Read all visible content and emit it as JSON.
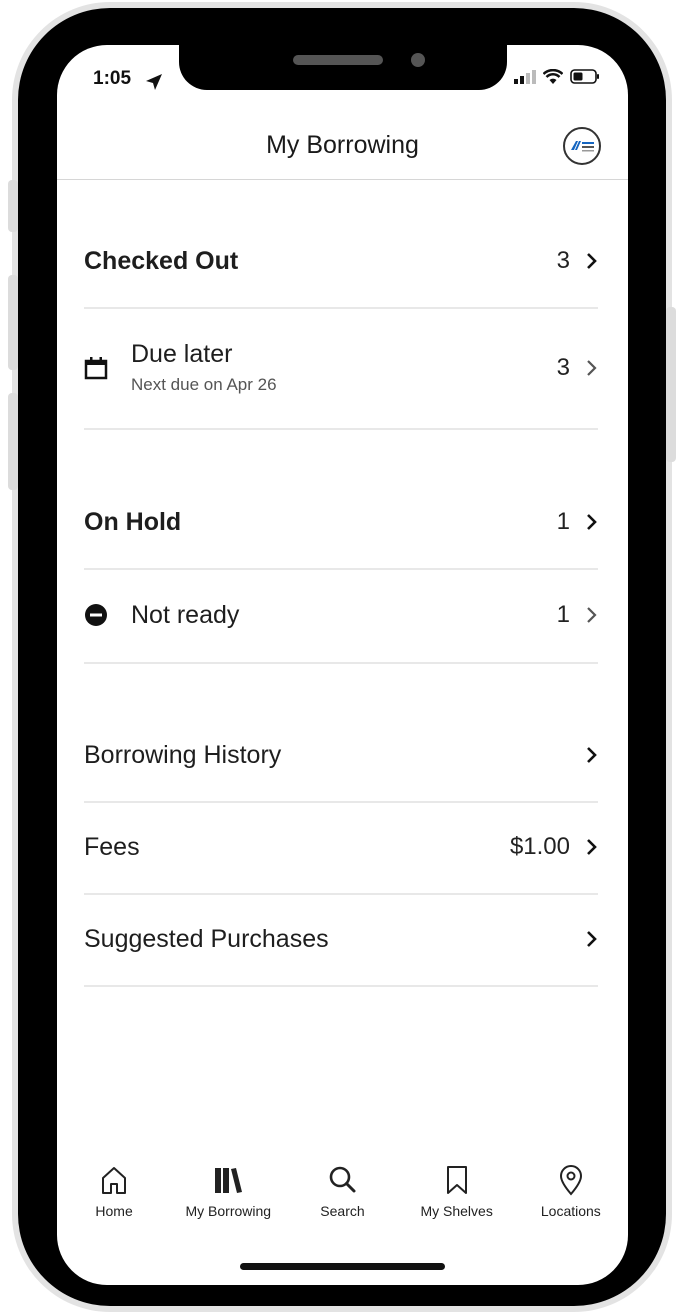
{
  "status_bar": {
    "time": "1:05"
  },
  "header": {
    "title": "My Borrowing"
  },
  "checked_out": {
    "label": "Checked Out",
    "count": "3",
    "due_later": {
      "label": "Due later",
      "subtitle": "Next due on Apr 26",
      "count": "3"
    }
  },
  "on_hold": {
    "label": "On Hold",
    "count": "1",
    "not_ready": {
      "label": "Not ready",
      "count": "1"
    }
  },
  "links": {
    "history": {
      "label": "Borrowing History"
    },
    "fees": {
      "label": "Fees",
      "value": "$1.00"
    },
    "suggested": {
      "label": "Suggested Purchases"
    }
  },
  "tabs": [
    {
      "label": "Home",
      "icon": "home-icon"
    },
    {
      "label": "My Borrowing",
      "icon": "books-icon"
    },
    {
      "label": "Search",
      "icon": "search-icon"
    },
    {
      "label": "My Shelves",
      "icon": "bookmark-icon"
    },
    {
      "label": "Locations",
      "icon": "location-pin-icon"
    }
  ],
  "colors": {
    "text": "#1e1e1e",
    "divider": "#e8e8e8",
    "frame": "#000000"
  }
}
